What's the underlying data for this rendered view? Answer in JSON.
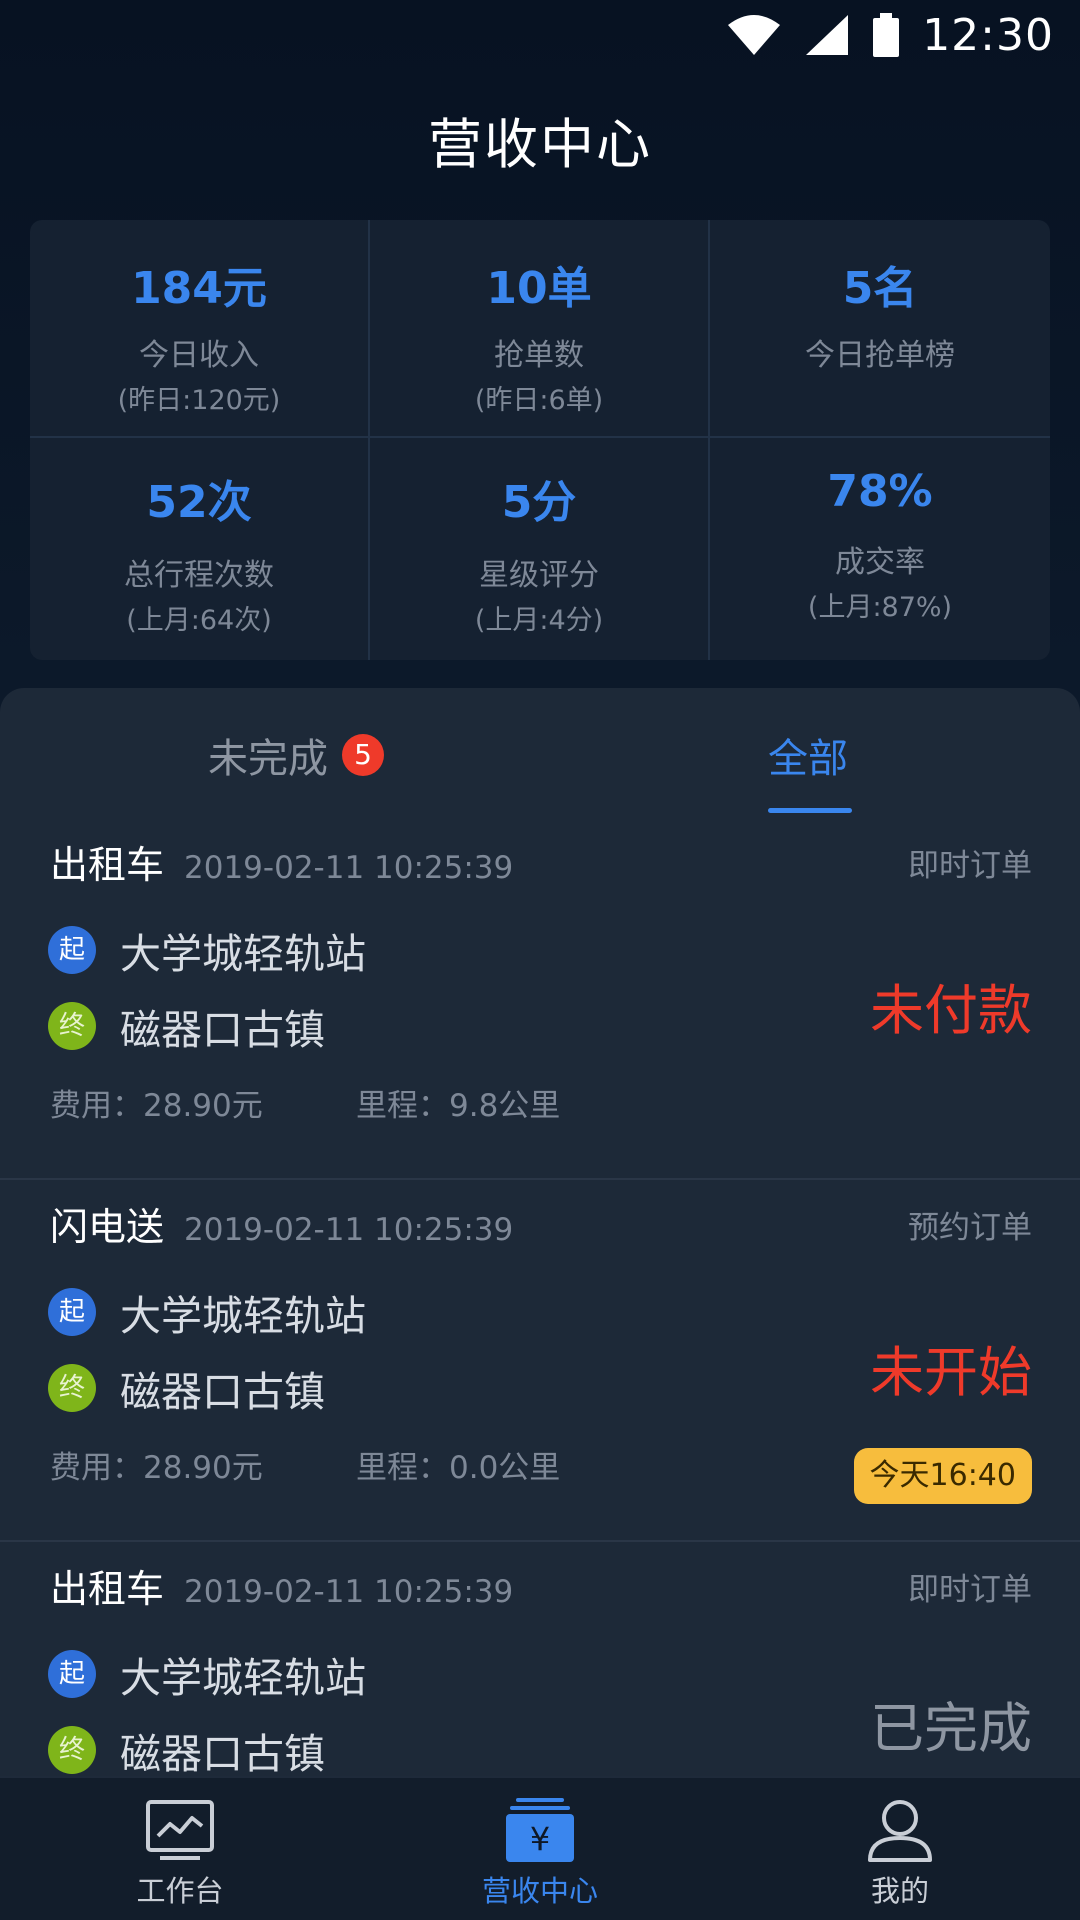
{
  "status_bar": {
    "time": "12:30"
  },
  "header": {
    "title": "营收中心"
  },
  "stats": [
    {
      "value": "184元",
      "label": "今日收入",
      "sub": "(昨日:120元)"
    },
    {
      "value": "10单",
      "label": "抢单数",
      "sub": "(昨日:6单)"
    },
    {
      "value": "5名",
      "label": "今日抢单榜",
      "sub": ""
    },
    {
      "value": "52次",
      "label": "总行程次数",
      "sub": "(上月:64次)"
    },
    {
      "value": "5分",
      "label": "星级评分",
      "sub": "(上月:4分)"
    },
    {
      "value": "78%",
      "label": "成交率",
      "sub": "(上月:87%)"
    }
  ],
  "tabs": {
    "unfinished": {
      "label": "未完成",
      "badge": "5"
    },
    "all": {
      "label": "全部"
    },
    "active": "all"
  },
  "orders": [
    {
      "type": "出租车",
      "time": "2019-02-11 10:25:39",
      "kind": "即时订单",
      "start_mark": "起",
      "start": "大学城轻轨站",
      "end_mark": "终",
      "end": "磁器口古镇",
      "fee": "费用：28.90元",
      "distance": "里程：9.8公里",
      "status": "未付款",
      "pill": ""
    },
    {
      "type": "闪电送",
      "time": "2019-02-11 10:25:39",
      "kind": "预约订单",
      "start_mark": "起",
      "start": "大学城轻轨站",
      "end_mark": "终",
      "end": "磁器口古镇",
      "fee": "费用：28.90元",
      "distance": "里程：0.0公里",
      "status": "未开始",
      "pill": "今天16:40"
    },
    {
      "type": "出租车",
      "time": "2019-02-11 10:25:39",
      "kind": "即时订单",
      "start_mark": "起",
      "start": "大学城轻轨站",
      "end_mark": "终",
      "end": "磁器口古镇",
      "status": "已完成"
    }
  ],
  "bottom_nav": {
    "items": [
      {
        "label": "工作台",
        "icon": "chart-monitor-icon"
      },
      {
        "label": "营收中心",
        "icon": "yuan-wallet-icon"
      },
      {
        "label": "我的",
        "icon": "user-icon"
      }
    ],
    "active_index": 1
  },
  "colors": {
    "accent": "#3a86ee",
    "danger": "#ef3a2a",
    "warning": "#f7bd3d",
    "start_dot": "#2f6fd9",
    "end_dot": "#7fb51a"
  }
}
